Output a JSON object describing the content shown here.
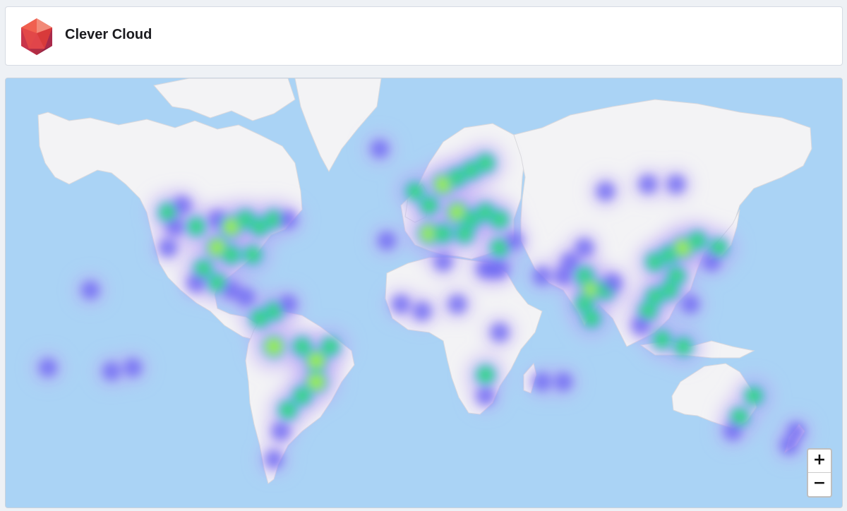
{
  "header": {
    "brand_name": "Clever Cloud",
    "logo_icon": "clever-cloud-logo-icon",
    "logo_colors": [
      "#f0604f",
      "#d83a3a",
      "#a9294a",
      "#e84f4a"
    ]
  },
  "map": {
    "type": "heatmap",
    "ocean_color": "#aad3f5",
    "land_color": "#f3f3f5",
    "heat_gradient": [
      "#b9a5f5",
      "#6f6cf2",
      "#3aa4f2",
      "#35e06a",
      "#b8f23a"
    ],
    "zoom_in_label": "+",
    "zoom_out_label": "−"
  }
}
